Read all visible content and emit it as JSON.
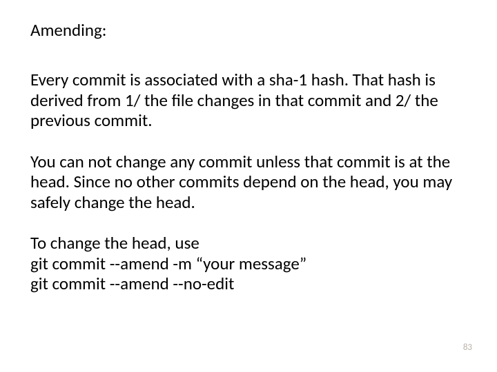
{
  "heading": "Amending:",
  "para1": "Every commit is associated with a sha-1 hash. That hash is derived from 1/ the file changes in that commit and 2/ the previous commit.",
  "para2": "You can not change any commit unless that commit is at the head.  Since no other commits depend on the head, you may safely change the head.",
  "para3_line1": "To change the head, use",
  "para3_line2": "git commit --amend -m “your message”",
  "para3_line3": "git commit --amend --no-edit",
  "page_number": "83"
}
